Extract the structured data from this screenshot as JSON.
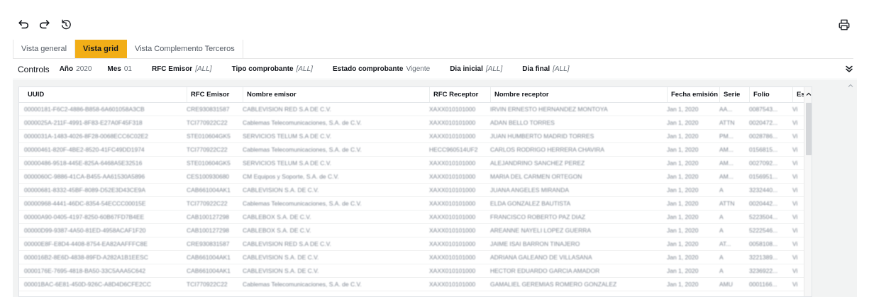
{
  "toolbar": {
    "undo_icon": "undo-icon",
    "redo_icon": "redo-icon",
    "reset_icon": "reset-icon",
    "print_icon": "print-icon"
  },
  "tabs": [
    {
      "label": "Vista general",
      "active": false
    },
    {
      "label": "Vista grid",
      "active": true
    },
    {
      "label": "Vista Complemento Terceros",
      "active": false
    }
  ],
  "controls": {
    "title": "Controls",
    "items": [
      {
        "label": "Año",
        "value": "2020",
        "italic": false
      },
      {
        "label": "Mes",
        "value": "01",
        "italic": false
      },
      {
        "label": "RFC Emisor",
        "value": "[ALL]",
        "italic": true
      },
      {
        "label": "Tipo comprobante",
        "value": "[ALL]",
        "italic": true
      },
      {
        "label": "Estado comprobante",
        "value": "Vigente",
        "italic": false
      },
      {
        "label": "Dia inicial",
        "value": "[ALL]",
        "italic": true
      },
      {
        "label": "Dia final",
        "value": "[ALL]",
        "italic": true
      }
    ]
  },
  "grid": {
    "columns": [
      "UUID",
      "RFC Emisor",
      "Nombre emisor",
      "RFC Receptor",
      "Nombre receptor",
      "Fecha emisión",
      "Serie",
      "Folio",
      "Es"
    ],
    "rows": [
      [
        "00000181-F6C2-4886-B858-6A601058A3CB",
        "CRE930831587",
        "CABLEVISION RED S.A DE C.V.",
        "XAXX010101000",
        "IRVIN ERNESTO HERNANDEZ MONTOYA",
        "Jan 1, 2020",
        "AA...",
        "0087543...",
        "Vi"
      ],
      [
        "0000025A-211F-4991-8F83-E27A0F45F318",
        "TCI770922C22",
        "Cablemas Telecomunicaciones, S.A. de C.V.",
        "XAXX010101000",
        "ADAN BELLO TORRES",
        "Jan 1, 2020",
        "ATTN",
        "0020472...",
        "Vi"
      ],
      [
        "0000031A-1483-4026-8F28-0068ECC6C02E2",
        "STE010604GK5",
        "SERVICIOS TELUM S.A DE C.V.",
        "XAXX010101000",
        "JUAN HUMBERTO MADRID TORRES",
        "Jan 1, 2020",
        "PM...",
        "0028786...",
        "Vi"
      ],
      [
        "00000461-820F-4BE2-8520-41FC49DD1974",
        "TCI770922C22",
        "Cablemas Telecomunicaciones, S.A. de C.V.",
        "HECC960514UF2",
        "CARLOS RODRIGO HERRERA CHAVIRA",
        "Jan 1, 2020",
        "AM...",
        "0156815...",
        "Vi"
      ],
      [
        "00000486-9518-445E-825A-6468A5E32516",
        "STE010604GK5",
        "SERVICIOS TELUM S.A DE C.V.",
        "XAXX010101000",
        "ALEJANDRINO SANCHEZ PEREZ",
        "Jan 1, 2020",
        "AM...",
        "0027092...",
        "Vi"
      ],
      [
        "0000060C-9886-41CA-B455-AA61530A5896",
        "CES100930680",
        "CM Equipos y Soporte, S.A. de C.V.",
        "XAXX010101000",
        "MARIA DEL CARMEN ORTEGON",
        "Jan 1, 2020",
        "AM...",
        "0156951...",
        "Vi"
      ],
      [
        "00000681-8332-45BF-8089-D52E3D43CE9A",
        "CAB661004AK1",
        "CABLEVISION S.A. DE C.V.",
        "XAXX010101000",
        "JUANA ANGELES MIRANDA",
        "Jan 1, 2020",
        "A",
        "3232440...",
        "Vi"
      ],
      [
        "00000968-4441-46DC-8354-54ECCC00015E",
        "TCI770922C22",
        "Cablemas Telecomunicaciones, S.A. de C.V.",
        "XAXX010101000",
        "ELDA GONZALEZ BAUTISTA",
        "Jan 1, 2020",
        "ATTN",
        "0020442...",
        "Vi"
      ],
      [
        "00000A90-0405-4197-8250-60B67FD7B4EE",
        "CAB100127298",
        "CABLEBOX S.A. DE C.V.",
        "XAXX010101000",
        "FRANCISCO ROBERTO PAZ DIAZ",
        "Jan 1, 2020",
        "A",
        "5223504...",
        "Vi"
      ],
      [
        "00000D99-9387-4A50-81ED-4958ACAF1F20",
        "CAB100127298",
        "CABLEBOX S.A. DE C.V.",
        "XAXX010101000",
        "AREANNE NAYELI LOPEZ GUERRA",
        "Jan 1, 2020",
        "A",
        "5222546...",
        "Vi"
      ],
      [
        "00000E8F-E8D4-4408-8754-EA82AAFFFC8E",
        "CRE930831587",
        "CABLEVISION RED S.A DE C.V.",
        "XAXX010101000",
        "JAIME ISAI BARRON TINAJERO",
        "Jan 1, 2020",
        "AT...",
        "0058108...",
        "Vi"
      ],
      [
        "000016B2-8E6D-4838-89FD-A282A1B1EESC",
        "CAB661004AK1",
        "CABLEVISION S.A. DE C.V.",
        "XAXX010101000",
        "ADRIANA GALEANO DE VILLASANA",
        "Jan 1, 2020",
        "A",
        "3221389...",
        "Vi"
      ],
      [
        "0000176E-7695-4818-BA50-33C5AAA5C642",
        "CAB661004AK1",
        "CABLEVISION S.A. DE C.V.",
        "XAXX010101000",
        "HECTOR EDUARDO GARCIA AMADOR",
        "Jan 1, 2020",
        "A",
        "3236922...",
        "Vi"
      ],
      [
        "00001BAC-6E81-450D-926C-A8D4D6CFE2CC",
        "TCI770922C22",
        "Cablemas Telecomunicaciones, S.A. de C.V.",
        "XAXX010101000",
        "GAMALIEL GEREMIAS ROMERO GONZALEZ",
        "Jan 1, 2020",
        "AMU",
        "0001166...",
        "Vi"
      ]
    ]
  }
}
